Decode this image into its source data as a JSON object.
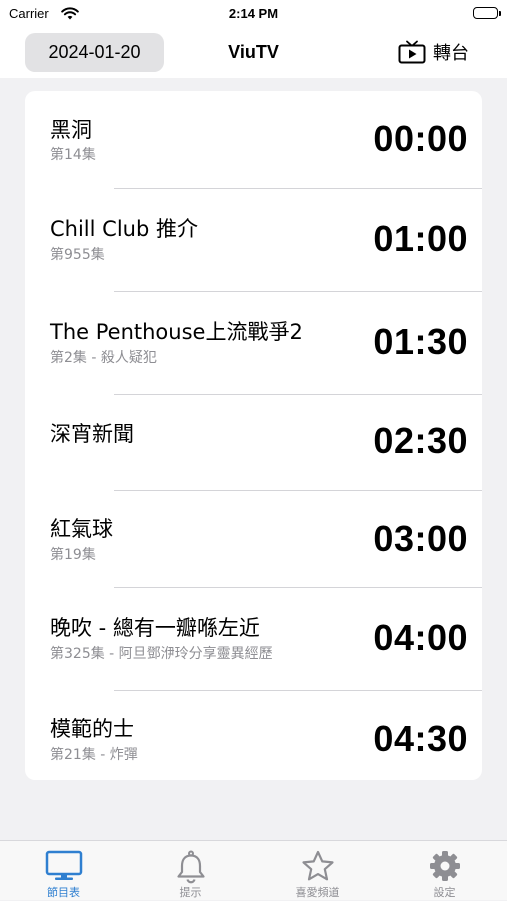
{
  "status_bar": {
    "carrier": "Carrier",
    "time": "2:14 PM"
  },
  "nav": {
    "date": "2024-01-20",
    "title": "ViuTV",
    "switch_label": "轉台"
  },
  "programs": [
    {
      "title": "黑洞",
      "subtitle": "第14集",
      "time": "00:00"
    },
    {
      "title": "Chill Club 推介",
      "subtitle": "第955集",
      "time": "01:00"
    },
    {
      "title": "The Penthouse上流戰爭2",
      "subtitle": "第2集 - 殺人疑犯",
      "time": "01:30"
    },
    {
      "title": "深宵新聞",
      "subtitle": "",
      "time": "02:30"
    },
    {
      "title": "紅氣球",
      "subtitle": "第19集",
      "time": "03:00"
    },
    {
      "title": "晚吹 - 總有一瓣喺左近",
      "subtitle": "第325集 - 阿旦鄧洢玲分享靈異經歷",
      "time": "04:00"
    },
    {
      "title": "模範的士",
      "subtitle": "第21集 - 炸彈",
      "time": "04:30"
    }
  ],
  "tabs": [
    {
      "label": "節目表",
      "icon": "tv-icon",
      "active": true
    },
    {
      "label": "提示",
      "icon": "bell-icon",
      "active": false
    },
    {
      "label": "喜愛頻道",
      "icon": "star-icon",
      "active": false
    },
    {
      "label": "設定",
      "icon": "gear-icon",
      "active": false
    }
  ],
  "colors": {
    "accent": "#2f7fd0",
    "inactive": "#8e8e93",
    "background": "#f1f1f3",
    "date_button": "#e2e2e4"
  }
}
